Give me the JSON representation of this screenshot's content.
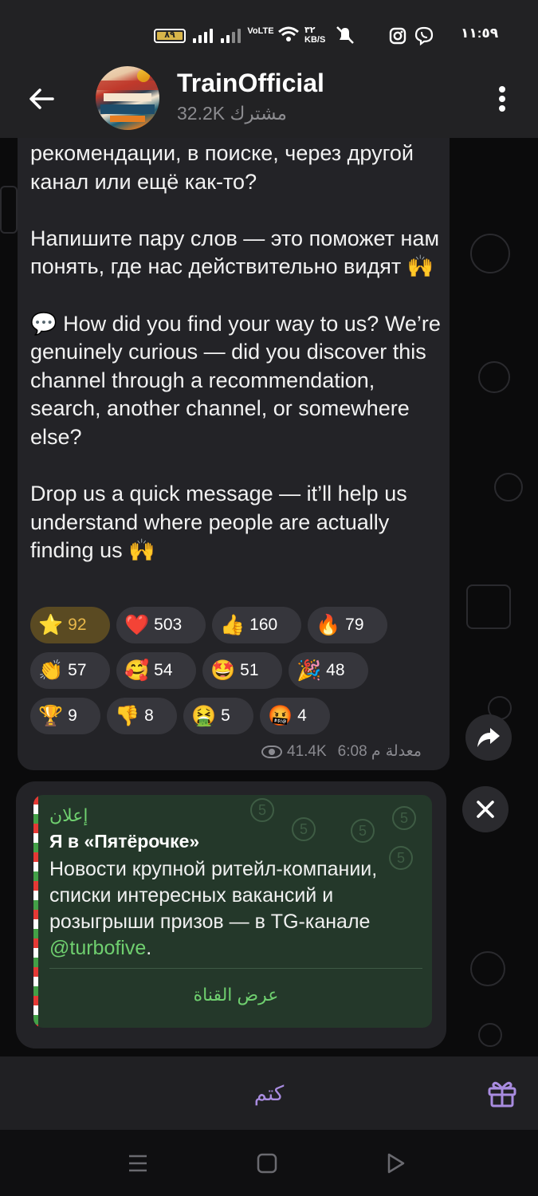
{
  "status_bar": {
    "battery": "٨٩",
    "network": "VoLTE",
    "speed": "٣٢ KB/S",
    "time": "١١:٥٩"
  },
  "header": {
    "channel_name": "TrainOfficial",
    "subscribers": "32.2K مشترك"
  },
  "message": {
    "paragraphs": [
      "рекомендации, в поиске, через другой канал или ещё как-то?",
      "Напишите пару слов — это поможет нам понять, где нас действительно видят 🙌",
      "💬 How did you find your way to us? We’re genuinely curious — did you discover this channel through a recommendation, search, another channel, or somewhere else?",
      "Drop us a quick message — it’ll help us understand where people are actually finding us 🙌"
    ],
    "reactions": [
      [
        {
          "emoji": "⭐",
          "count": "92",
          "highlight": true
        },
        {
          "emoji": "❤️",
          "count": "503"
        },
        {
          "emoji": "👍",
          "count": "160"
        },
        {
          "emoji": "🔥",
          "count": "79"
        }
      ],
      [
        {
          "emoji": "👏",
          "count": "57"
        },
        {
          "emoji": "🥰",
          "count": "54"
        },
        {
          "emoji": "🤩",
          "count": "51"
        },
        {
          "emoji": "🎉",
          "count": "48"
        }
      ],
      [
        {
          "emoji": "🏆",
          "count": "9"
        },
        {
          "emoji": "👎",
          "count": "8"
        },
        {
          "emoji": "🤮",
          "count": "5"
        },
        {
          "emoji": "🤬",
          "count": "4"
        }
      ]
    ],
    "views": "41.4K",
    "time": "م 6:08",
    "edited": "معدلة"
  },
  "ad": {
    "label": "إعلان",
    "title": "Я в «Пятёрочке»",
    "text": "Новости крупной ритейл-компании, списки интересных вакансий и розыгрыши призов — в TG-канале ",
    "link": "@turbofive",
    "text_end": ".",
    "button": "عرض القناة"
  },
  "bottom": {
    "mute_label": "كتم"
  },
  "colors": {
    "accent_purple": "#a98ce0",
    "ad_green": "#6fcf6f",
    "star_gold": "#e8b84a"
  }
}
